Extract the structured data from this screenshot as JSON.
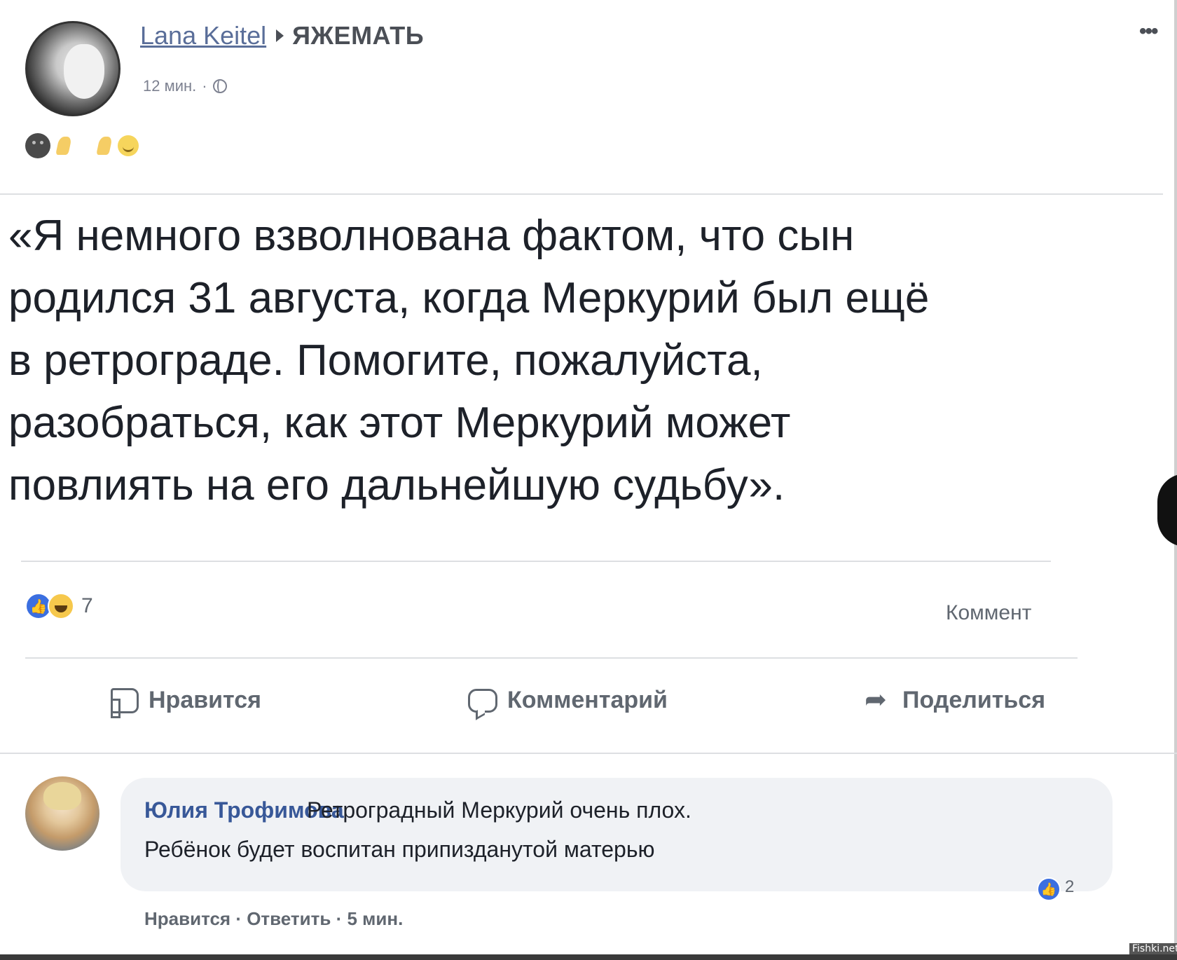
{
  "post": {
    "author": "Lana Keitel",
    "group": "ЯЖЕМАТЬ",
    "time": "12 мин.",
    "text": "«Я немного взволнована фактом, что сын\nродился 31 августа, когда Меркурий был ещё\nв ретрограде. Помогите, пожалуйста,\nразобраться, как этот Меркурий может\nповлиять на его дальнейшую судьбу».",
    "reactions_count": "7",
    "comments_label": "Коммент"
  },
  "actions": {
    "like": "Нравится",
    "comment": "Комментарий",
    "share": "Поделиться"
  },
  "comment": {
    "author": "Юлия Трофимова",
    "text_line1": "Ретроградный Меркурий очень плох.",
    "text_line2": "Ребёнок будет воспитан припизданутой матерью",
    "reactions_count": "2",
    "meta": "Нравится · Ответить · 5 мин."
  },
  "watermark": "Fishki.net",
  "icons": {
    "more": "more-icon",
    "privacy": "globe-icon",
    "like_action": "thumbs-up-icon",
    "comment_action": "speech-bubble-icon",
    "share_action": "share-arrow-icon"
  },
  "colors": {
    "author_link": "#5a6e99",
    "comment_author": "#385898",
    "like_blue": "#3b6fe0",
    "muted_text": "#606770"
  }
}
